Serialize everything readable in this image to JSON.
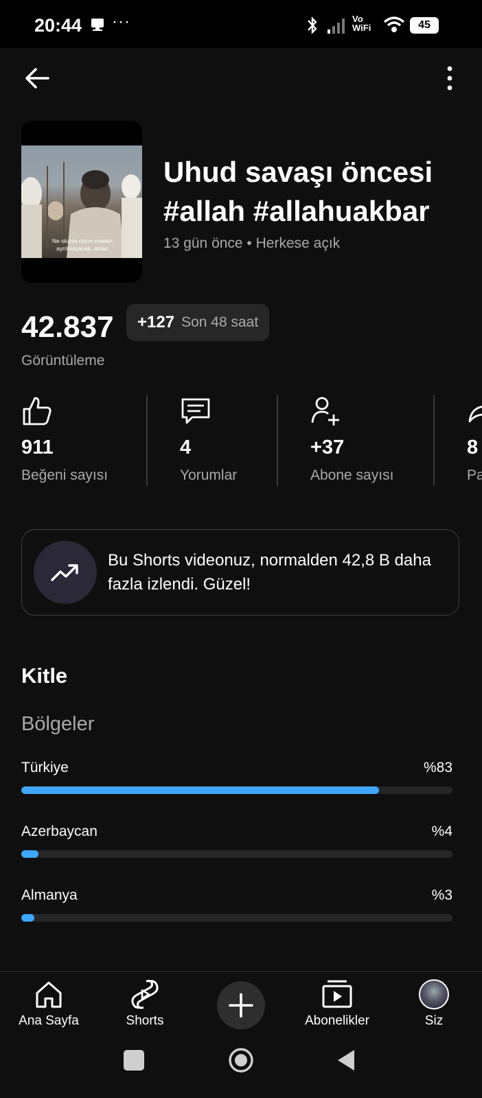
{
  "status_bar": {
    "time": "20:44",
    "battery": "45",
    "network": "Vo WiFi"
  },
  "header": {
    "back_icon": "arrow-left-icon",
    "more_icon": "more-vert-icon"
  },
  "video": {
    "thumbnail_subtitle": "Ne olursa olsun oradan ayrılmayacak, atıları",
    "title": "Uhud savaşı öncesi #allah #allahuakbar",
    "meta": "13 gün önce • Herkese açık"
  },
  "views": {
    "count": "42.837",
    "delta": "+127",
    "period": "Son 48 saat",
    "label": "Görüntüleme"
  },
  "stats": [
    {
      "icon": "thumb-up-icon",
      "value": "911",
      "label": "Beğeni sayısı"
    },
    {
      "icon": "comment-icon",
      "value": "4",
      "label": "Yorumlar"
    },
    {
      "icon": "person-add-icon",
      "value": "+37",
      "label": "Abone sayısı"
    },
    {
      "icon": "share-icon",
      "value": "8",
      "label": "Pa"
    }
  ],
  "insight": {
    "icon": "trending-up-icon",
    "text": "Bu Shorts videonuz, normalden 42,8 B daha fazla izlendi. Güzel!"
  },
  "audience": {
    "heading": "Kitle",
    "regions_heading": "Bölgeler",
    "regions": [
      {
        "name": "Türkiye",
        "percent_label": "%83",
        "fraction": 0.83
      },
      {
        "name": "Azerbaycan",
        "percent_label": "%4",
        "fraction": 0.04
      },
      {
        "name": "Almanya",
        "percent_label": "%3",
        "fraction": 0.03
      }
    ]
  },
  "bottom_nav": [
    {
      "icon": "home-icon",
      "label": "Ana Sayfa"
    },
    {
      "icon": "shorts-icon",
      "label": "Shorts"
    },
    {
      "icon": "plus-icon",
      "label": ""
    },
    {
      "icon": "subscriptions-icon",
      "label": "Abonelikler"
    },
    {
      "icon": "avatar",
      "label": "Siz"
    }
  ],
  "colors": {
    "background": "#0f0f0f",
    "accent": "#3ea6ff",
    "muted_text": "#aaaaaa"
  }
}
